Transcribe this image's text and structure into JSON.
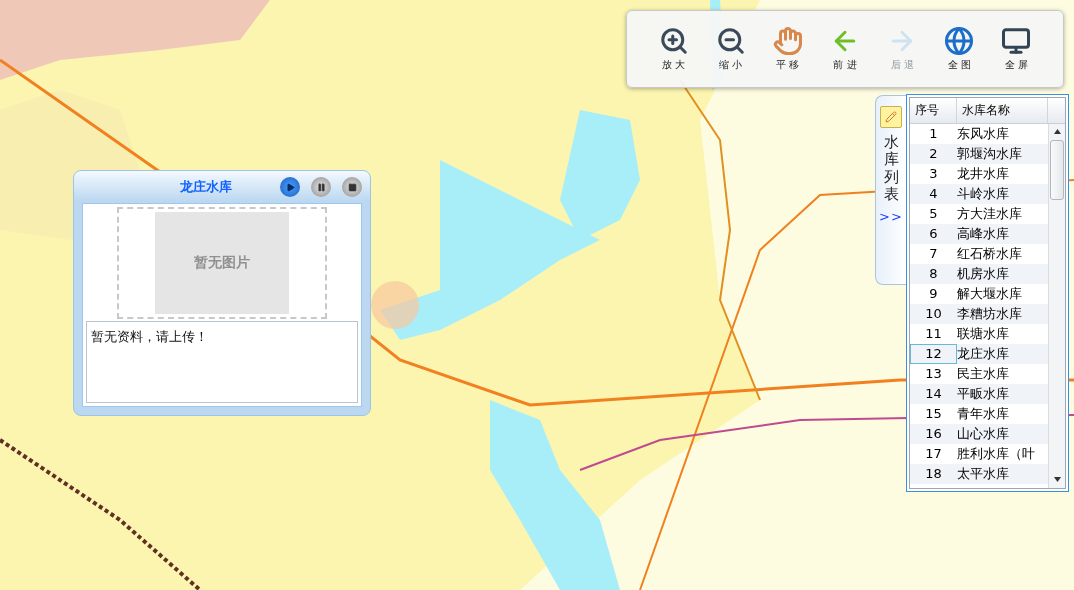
{
  "toolbar": {
    "buttons": [
      {
        "kind": "zoom-in",
        "label": "放 大",
        "disabled": false
      },
      {
        "kind": "zoom-out",
        "label": "缩 小",
        "disabled": false
      },
      {
        "kind": "pan",
        "label": "平 移",
        "disabled": false
      },
      {
        "kind": "forward",
        "label": "前 进",
        "disabled": false
      },
      {
        "kind": "back",
        "label": "后 退",
        "disabled": true
      },
      {
        "kind": "full-extent",
        "label": "全 图",
        "disabled": false
      },
      {
        "kind": "fullscreen",
        "label": "全 屏",
        "disabled": false
      }
    ]
  },
  "popup": {
    "title": "龙庄水库",
    "controls": [
      {
        "kind": "play",
        "selected": true
      },
      {
        "kind": "pause",
        "selected": false
      },
      {
        "kind": "stop",
        "selected": false
      }
    ],
    "image_placeholder": "暂无图片",
    "description": "暂无资料，请上传！"
  },
  "side_tab": {
    "label": "水库列表",
    "toggle": ">>"
  },
  "table": {
    "columns": [
      "序号",
      "水库名称"
    ],
    "rows": [
      {
        "no": "1",
        "name": "东风水库",
        "selected": false
      },
      {
        "no": "2",
        "name": "郭堰沟水库",
        "selected": false
      },
      {
        "no": "3",
        "name": "龙井水库",
        "selected": false
      },
      {
        "no": "4",
        "name": "斗岭水库",
        "selected": false
      },
      {
        "no": "5",
        "name": "方大洼水库",
        "selected": false
      },
      {
        "no": "6",
        "name": "高峰水库",
        "selected": false
      },
      {
        "no": "7",
        "name": "红石桥水库",
        "selected": false
      },
      {
        "no": "8",
        "name": "机房水库",
        "selected": false
      },
      {
        "no": "9",
        "name": "解大堰水库",
        "selected": false
      },
      {
        "no": "10",
        "name": "李糟坊水库",
        "selected": false
      },
      {
        "no": "11",
        "name": "联塘水库",
        "selected": false
      },
      {
        "no": "12",
        "name": "龙庄水库",
        "selected": true
      },
      {
        "no": "13",
        "name": "民主水库",
        "selected": false
      },
      {
        "no": "14",
        "name": "平畈水库",
        "selected": false
      },
      {
        "no": "15",
        "name": "青年水库",
        "selected": false
      },
      {
        "no": "16",
        "name": "山心水库",
        "selected": false
      },
      {
        "no": "17",
        "name": "胜利水库（叶",
        "selected": false
      },
      {
        "no": "18",
        "name": "太平水库",
        "selected": false
      }
    ]
  }
}
